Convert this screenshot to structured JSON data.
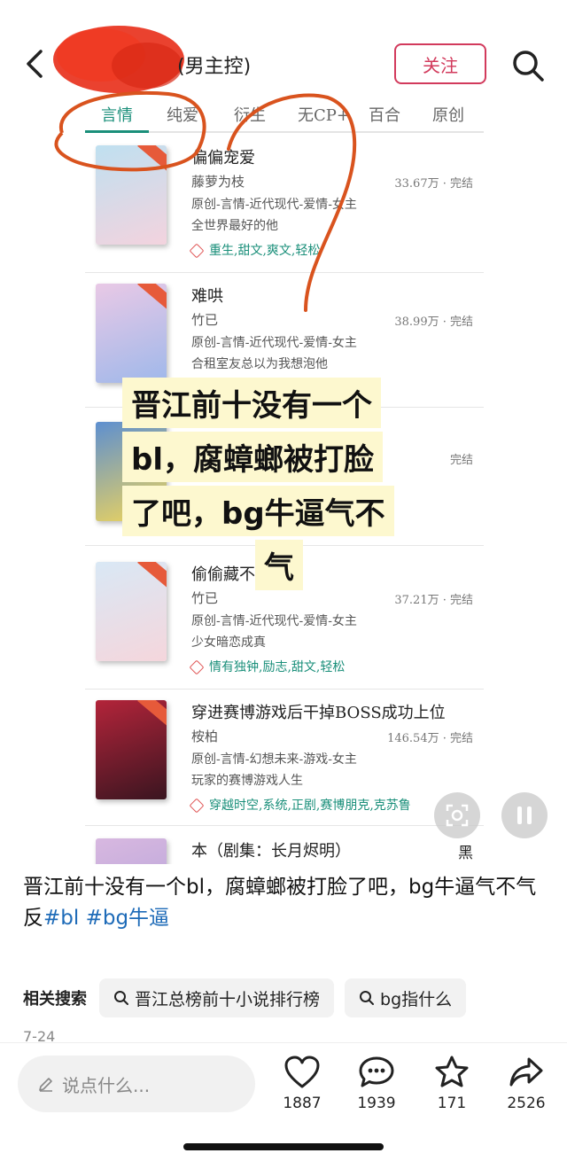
{
  "header": {
    "title_suffix": "(男主控)",
    "follow_label": "关注"
  },
  "tabs": [
    "言情",
    "纯爱",
    "衍生",
    "无CP+",
    "百合",
    "原创"
  ],
  "books": [
    {
      "title": "偏偏宠爱",
      "author": "藤萝为枝",
      "stat": "33.67万 · 完结",
      "genre": "原创-言情-近代现代-爱情-女主",
      "desc": "全世界最好的他",
      "tags": "重生,甜文,爽文,轻松",
      "cover_colors": [
        "#bfe0f0",
        "#f3d3de"
      ]
    },
    {
      "title": "难哄",
      "author": "竹已",
      "stat": "38.99万 · 完结",
      "genre": "原创-言情-近代现代-爱情-女主",
      "desc": "合租室友总以为我想泡他",
      "tags": "",
      "cover_colors": [
        "#e9c9e6",
        "#9fb8ea"
      ]
    },
    {
      "title": "",
      "author": "",
      "stat": "完结",
      "genre": "",
      "desc": "",
      "tags": "",
      "cover_colors": [
        "#5d8fd0",
        "#f1d65a"
      ]
    },
    {
      "title": "偷偷藏不",
      "author": "竹已",
      "stat": "37.21万 · 完结",
      "genre": "原创-言情-近代现代-爱情-女主",
      "desc": "少女暗恋成真",
      "tags": "情有独钟,励志,甜文,轻松",
      "cover_colors": [
        "#d9e8f5",
        "#f5d6dc"
      ]
    },
    {
      "title": "穿进赛博游戏后干掉BOSS成功上位",
      "author": "桉柏",
      "stat": "146.54万 · 完结",
      "genre": "原创-言情-幻想未来-游戏-女主",
      "desc": "玩家的赛博游戏人生",
      "tags": "穿越时空,系统,正剧,赛博朋克,克苏鲁",
      "cover_colors": [
        "#b3243a",
        "#3a1520"
      ]
    },
    {
      "title": "本（剧集：长月烬明）",
      "author": "",
      "stat": "黑",
      "genre": "",
      "desc": "",
      "tags": "",
      "cover_colors": [
        "#d8b8e0",
        "#b0a0d8"
      ]
    }
  ],
  "overlay_caption": [
    "晋江前十没有一个",
    "bl，腐蟑螂被打脸",
    "了吧，bg牛逼气不",
    "气"
  ],
  "post": {
    "text": "晋江前十没有一个bl，腐蟑螂被打脸了吧，bg牛逼气不气",
    "prefix": "反",
    "hashtag1": "#bl",
    "hashtag2": "#bg牛逼"
  },
  "related": {
    "label": "相关搜索",
    "chips": [
      "晋江总榜前十小说排行榜",
      "bg指什么"
    ]
  },
  "date": "7-24",
  "bottom": {
    "comment_placeholder": "说点什么...",
    "likes": "1887",
    "comments": "1939",
    "favorites": "171",
    "shares": "2526"
  },
  "colors": {
    "accent_pink": "#d23a5c",
    "tab_green": "#1a8f7a",
    "link_blue": "#1e6bb8",
    "highlight": "#fdf8cf"
  }
}
